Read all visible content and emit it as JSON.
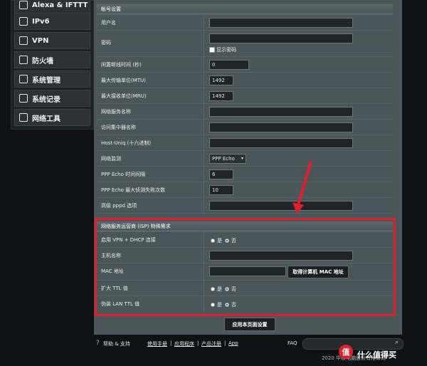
{
  "sidebar": {
    "items": [
      {
        "label": "Alexa & IFTTT",
        "icon": "alexa-icon"
      },
      {
        "label": "IPv6",
        "icon": "ipv6-icon"
      },
      {
        "label": "VPN",
        "icon": "vpn-icon"
      },
      {
        "label": "防火墙",
        "icon": "firewall-icon"
      },
      {
        "label": "系统管理",
        "icon": "gear-icon"
      },
      {
        "label": "系统记录",
        "icon": "log-icon"
      },
      {
        "label": "网络工具",
        "icon": "tools-icon"
      }
    ]
  },
  "account": {
    "title": "帐号设置",
    "username_label": "用户名",
    "password_label": "密码",
    "show_password": "显示密码",
    "idle_label": "闲置断线时间 (秒)",
    "idle_value": "0",
    "mtu_label": "最大传输单位(MTU)",
    "mtu_value": "1492",
    "mru_label": "最大接收单位(MRU)",
    "mru_value": "1492",
    "service_label": "网络服务名称",
    "ac_label": "访问集中器名称",
    "hostuniq_label": "Host-Uniq (十六进制)",
    "monitor_label": "网络监测",
    "monitor_value": "PPP Echo",
    "echo_interval_label": "PPP Echo 时间间隔",
    "echo_interval_value": "6",
    "echo_fail_label": "PPP Echo 最大侦测失败次数",
    "echo_fail_value": "10",
    "pppd_label": "高级 pppd 选项"
  },
  "isp": {
    "title": "网络服务运营商 (ISP) 特殊需求",
    "vpn_dhcp_label": "启用 VPN + DHCP 连接",
    "host_label": "主机名称",
    "mac_label": "MAC 地址",
    "mac_button": "取得计算机 MAC 地址",
    "ttl_label": "扩大 TTL 值",
    "lan_ttl_label": "伪装 LAN TTL 值",
    "yes": "是",
    "no": "否"
  },
  "apply_button": "应用本页面设置",
  "footer": {
    "help": "帮助 & 支持",
    "manual": "使用手册",
    "app": "应用程序",
    "register": "产品注册",
    "app2": "App",
    "faq": "FAQ",
    "copyright": "2020 华硕电脑股份有限公司",
    "watermark": "值 什么值得买"
  },
  "colors": {
    "highlight": "#e01f2a",
    "accent": "#1a6aa8"
  }
}
